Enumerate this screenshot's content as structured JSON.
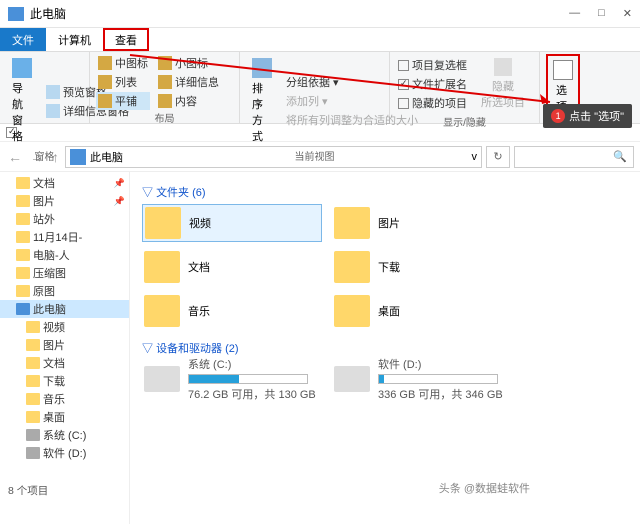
{
  "window": {
    "title": "此电脑",
    "min": "—",
    "max": "□",
    "close": "✕"
  },
  "tabs": {
    "file": "文件",
    "computer": "计算机",
    "view": "查看"
  },
  "ribbon": {
    "pane": {
      "nav": "导航窗格",
      "preview": "预览窗格",
      "detail": "详细信息窗格",
      "label": "窗格"
    },
    "layout": {
      "medium": "中图标",
      "small": "小图标",
      "list": "列表",
      "details": "详细信息",
      "tiles": "平铺",
      "content": "内容",
      "label": "布局"
    },
    "view": {
      "sort": "排序方式",
      "group": "分组依据 ▾",
      "addcol": "添加列 ▾",
      "fit": "将所有列调整为合适的大小",
      "label": "当前视图"
    },
    "show": {
      "itemchk": "项目复选框",
      "ext": "文件扩展名",
      "hidden": "隐藏的项目",
      "hide": "隐藏\n所选项目",
      "label": "显示/隐藏"
    },
    "options": "选项"
  },
  "callout": {
    "num": "1",
    "text": "点击 \"选项\""
  },
  "addr": {
    "crumb": "此电脑",
    "drop": "v",
    "refresh": "↻",
    "search": "🔍"
  },
  "tree": [
    {
      "icon": "y",
      "label": "文档",
      "pin": true
    },
    {
      "icon": "y",
      "label": "图片",
      "pin": true
    },
    {
      "icon": "y",
      "label": "站外"
    },
    {
      "icon": "y",
      "label": "11月14日-"
    },
    {
      "icon": "y",
      "label": "电脑-人"
    },
    {
      "icon": "y",
      "label": "压缩图"
    },
    {
      "icon": "y",
      "label": "原图"
    },
    {
      "icon": "b",
      "label": "此电脑",
      "sel": true
    },
    {
      "icon": "y",
      "label": "视频",
      "indent": true
    },
    {
      "icon": "y",
      "label": "图片",
      "indent": true
    },
    {
      "icon": "y",
      "label": "文档",
      "indent": true
    },
    {
      "icon": "y",
      "label": "下载",
      "indent": true
    },
    {
      "icon": "y",
      "label": "音乐",
      "indent": true
    },
    {
      "icon": "y",
      "label": "桌面",
      "indent": true
    },
    {
      "icon": "g",
      "label": "系统 (C:)",
      "indent": true
    },
    {
      "icon": "g",
      "label": "软件 (D:)",
      "indent": true
    }
  ],
  "content": {
    "folders_hdr": "文件夹 (6)",
    "folders": [
      {
        "name": "视频",
        "sel": true
      },
      {
        "name": "图片"
      },
      {
        "name": "文档"
      },
      {
        "name": "下载"
      },
      {
        "name": "音乐"
      },
      {
        "name": "桌面"
      }
    ],
    "drives_hdr": "设备和驱动器 (2)",
    "drives": [
      {
        "name": "系统 (C:)",
        "info": "76.2 GB 可用，共 130 GB",
        "fill": 42
      },
      {
        "name": "软件 (D:)",
        "info": "336 GB 可用，共 346 GB",
        "fill": 4
      }
    ]
  },
  "status": "8 个项目",
  "watermark": "头条 @数据蛙软件"
}
